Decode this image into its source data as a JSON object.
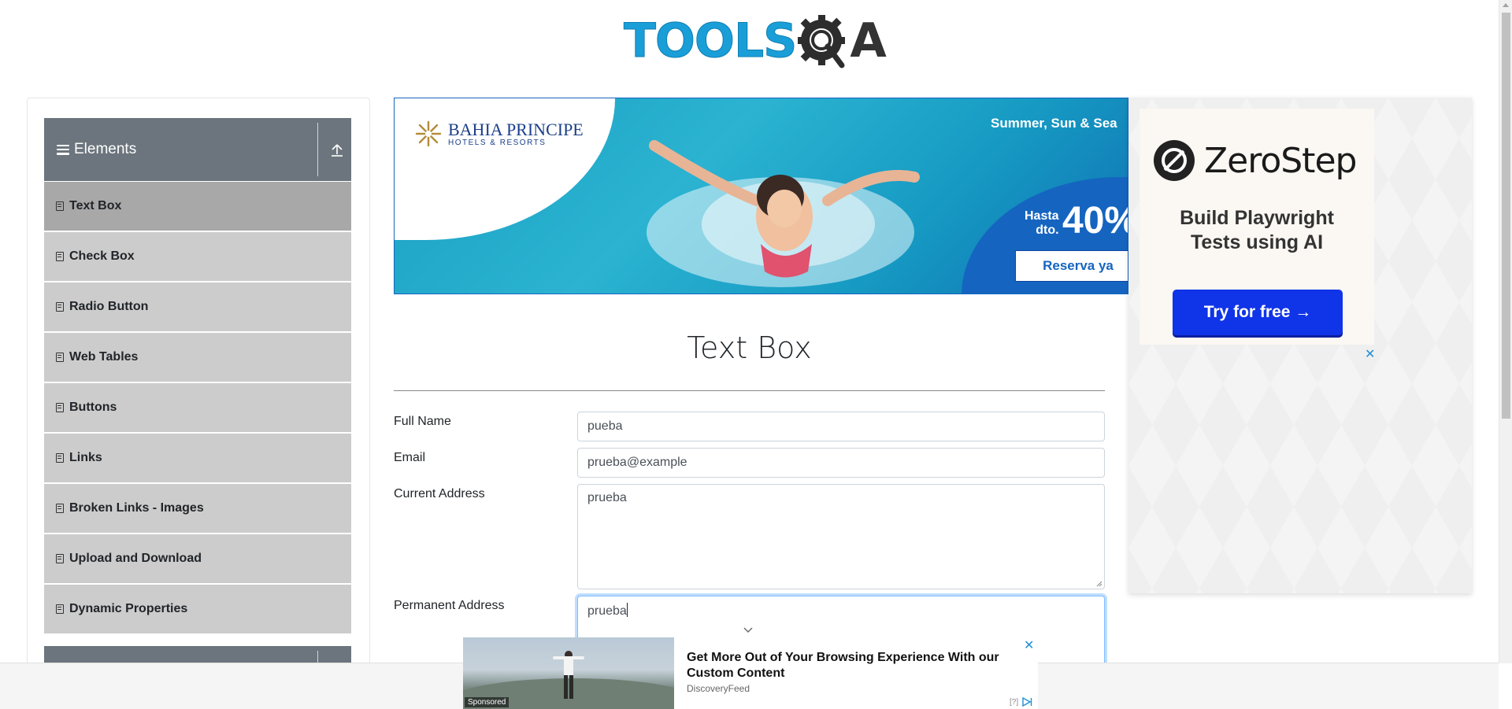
{
  "header": {
    "logo_part1": "TOOLS",
    "logo_part2": "A"
  },
  "sidebar": {
    "group_title": "Elements",
    "items": [
      {
        "label": "Text Box",
        "active": true
      },
      {
        "label": "Check Box"
      },
      {
        "label": "Radio Button"
      },
      {
        "label": "Web Tables"
      },
      {
        "label": "Buttons"
      },
      {
        "label": "Links"
      },
      {
        "label": "Broken Links - Images"
      },
      {
        "label": "Upload and Download"
      },
      {
        "label": "Dynamic Properties"
      }
    ]
  },
  "banner_ad": {
    "brand": "BAHIA PRINCIPE",
    "brand_sub": "HOTELS & RESORTS",
    "tagline": "Summer, Sun & Sea",
    "discount_prefix_1": "Hasta",
    "discount_prefix_2": "dto.",
    "discount": "40%",
    "cta": "Reserva ya"
  },
  "page": {
    "title": "Text Box"
  },
  "form": {
    "full_name_label": "Full Name",
    "full_name_value": "pueba",
    "email_label": "Email",
    "email_value": "prueba@example",
    "current_address_label": "Current Address",
    "current_address_value": "prueba",
    "permanent_address_label": "Permanent Address",
    "permanent_address_value": "prueba"
  },
  "side_ad": {
    "brand": "ZeroStep",
    "headline_line1": "Build Playwright",
    "headline_line2": "Tests using AI",
    "cta": "Try for free →",
    "close": "✕"
  },
  "bottom_ad": {
    "title": "Get More Out of Your Browsing Experience With our Custom Content",
    "source": "DiscoveryFeed",
    "sponsored": "Sponsored",
    "close": "✕",
    "adchoices": "[?]"
  },
  "colors": {
    "accent_blue": "#1a9ed8",
    "sidebar_header": "#6c757d",
    "menu_item": "#cccccc",
    "menu_item_active": "#a8a8a8",
    "cta_blue": "#1034e8"
  }
}
